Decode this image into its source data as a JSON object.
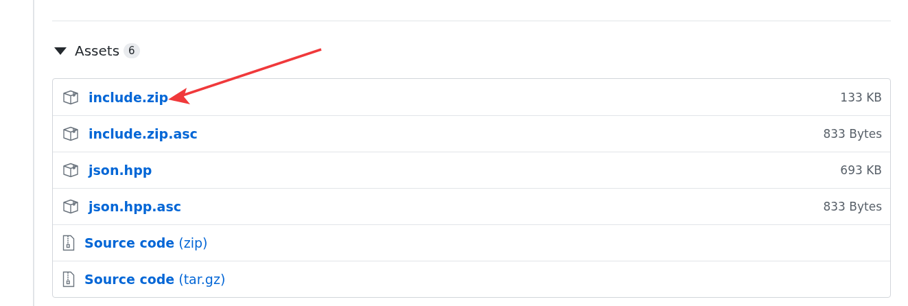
{
  "assets": {
    "title": "Assets",
    "count": "6",
    "expanded": true,
    "items": [
      {
        "kind": "package",
        "name": "include.zip",
        "size": "133 KB"
      },
      {
        "kind": "package",
        "name": "include.zip.asc",
        "size": "833 Bytes"
      },
      {
        "kind": "package",
        "name": "json.hpp",
        "size": "693 KB"
      },
      {
        "kind": "package",
        "name": "json.hpp.asc",
        "size": "833 Bytes"
      },
      {
        "kind": "source",
        "name": "Source code",
        "suffix": "(zip)"
      },
      {
        "kind": "source",
        "name": "Source code",
        "suffix": "(tar.gz)"
      }
    ]
  }
}
